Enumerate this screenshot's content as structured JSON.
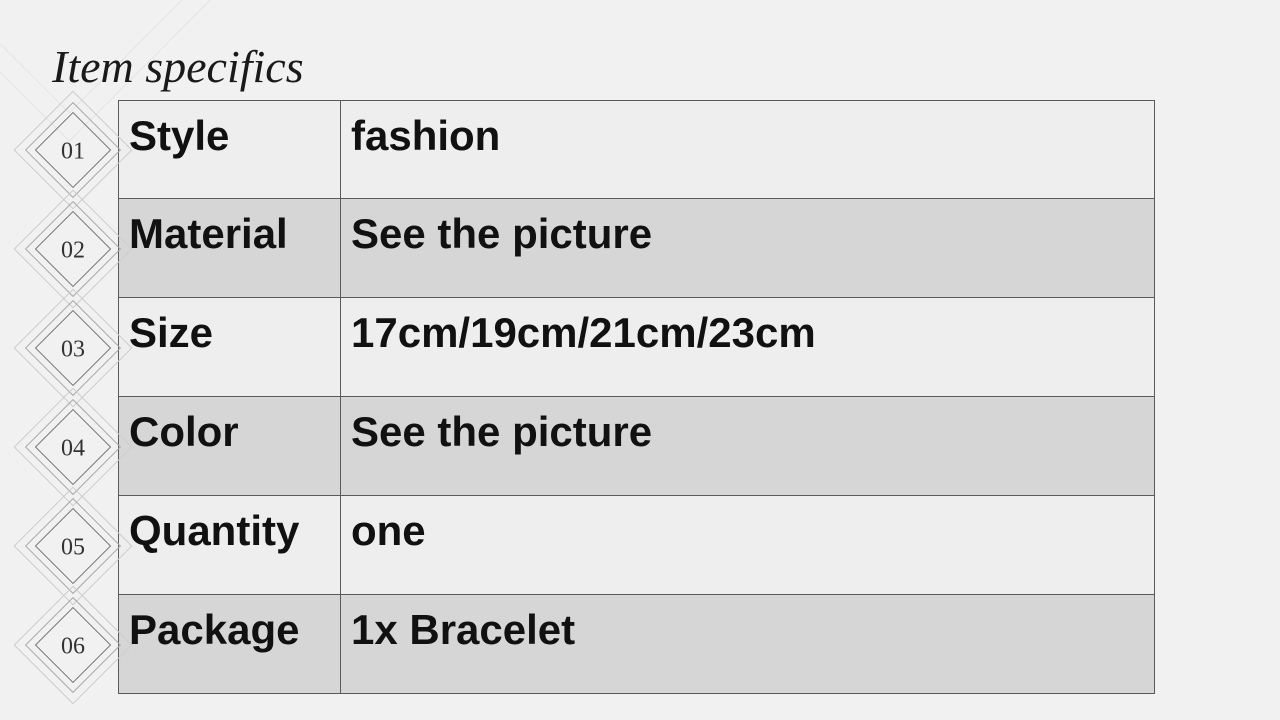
{
  "title": "Item specifics",
  "rows": [
    {
      "num": "01",
      "label": "Style",
      "value": "fashion"
    },
    {
      "num": "02",
      "label": "Material",
      "value": "See the picture"
    },
    {
      "num": "03",
      "label": "Size",
      "value": "17cm/19cm/21cm/23cm"
    },
    {
      "num": "04",
      "label": "Color",
      "value": "See the picture"
    },
    {
      "num": "05",
      "label": "Quantity",
      "value": "one"
    },
    {
      "num": "06",
      "label": "Package",
      "value": "1x Bracelet"
    }
  ]
}
